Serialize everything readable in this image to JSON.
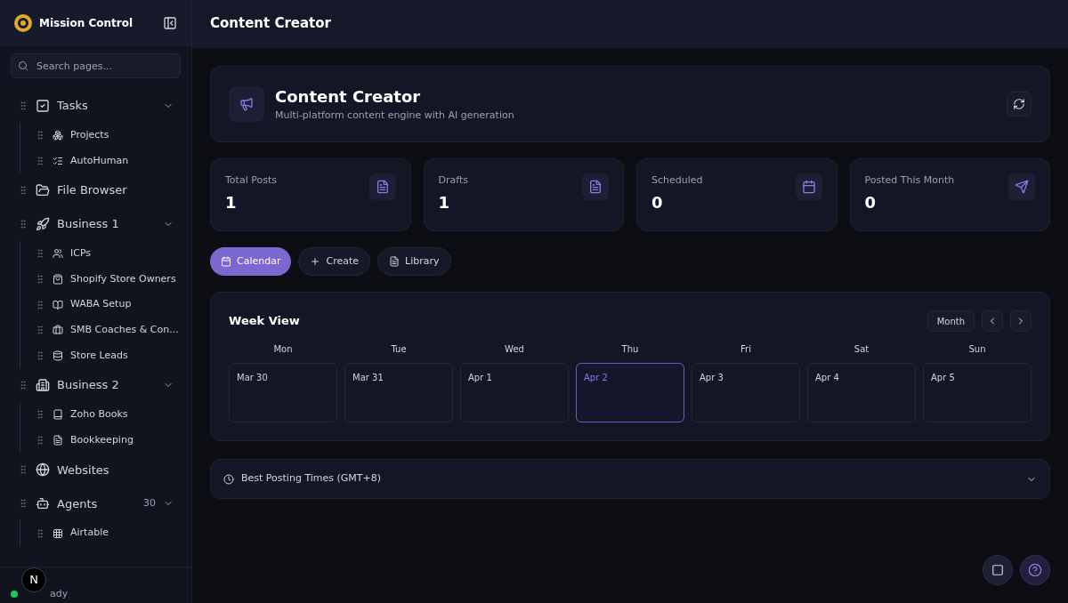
{
  "sidebar": {
    "app_name": "Mission Control",
    "search": {
      "placeholder": "Search pages..."
    },
    "items": [
      {
        "label": "Tasks",
        "expanded": true,
        "children": [
          {
            "label": "Projects"
          },
          {
            "label": "AutoHuman"
          }
        ]
      },
      {
        "label": "File Browser"
      },
      {
        "label": "Business 1",
        "expanded": true,
        "children": [
          {
            "label": "ICPs"
          },
          {
            "label": "Shopify Store Owners"
          },
          {
            "label": "WABA Setup"
          },
          {
            "label": "SMB Coaches & Con..."
          },
          {
            "label": "Store Leads"
          }
        ]
      },
      {
        "label": "Business 2",
        "expanded": true,
        "children": [
          {
            "label": "Zoho Books"
          },
          {
            "label": "Bookkeeping"
          }
        ]
      },
      {
        "label": "Websites"
      },
      {
        "label": "Agents",
        "count": "30",
        "expanded": true,
        "children": [
          {
            "label": "Airtable"
          }
        ]
      }
    ],
    "status": {
      "text": "ady",
      "color": "#22c55e"
    },
    "badge": "N"
  },
  "header": {
    "title": "Content Creator"
  },
  "hero": {
    "title": "Content Creator",
    "subtitle": "Multi-platform content engine with AI generation"
  },
  "stats": [
    {
      "label": "Total Posts",
      "value": "1"
    },
    {
      "label": "Drafts",
      "value": "1"
    },
    {
      "label": "Scheduled",
      "value": "0"
    },
    {
      "label": "Posted This Month",
      "value": "0"
    }
  ],
  "tabs": [
    {
      "label": "Calendar",
      "selected": true
    },
    {
      "label": "Create",
      "selected": false
    },
    {
      "label": "Library",
      "selected": false
    }
  ],
  "calendar": {
    "title": "Week View",
    "view_button": "Month",
    "days": [
      {
        "weekday": "Mon",
        "date": "Mar 30",
        "today": false
      },
      {
        "weekday": "Tue",
        "date": "Mar 31",
        "today": false
      },
      {
        "weekday": "Wed",
        "date": "Apr 1",
        "today": false
      },
      {
        "weekday": "Thu",
        "date": "Apr 2",
        "today": true
      },
      {
        "weekday": "Fri",
        "date": "Apr 3",
        "today": false
      },
      {
        "weekday": "Sat",
        "date": "Apr 4",
        "today": false
      },
      {
        "weekday": "Sun",
        "date": "Apr 5",
        "today": false
      }
    ]
  },
  "best_times": {
    "title": "Best Posting Times (GMT+8)",
    "expanded": false
  }
}
